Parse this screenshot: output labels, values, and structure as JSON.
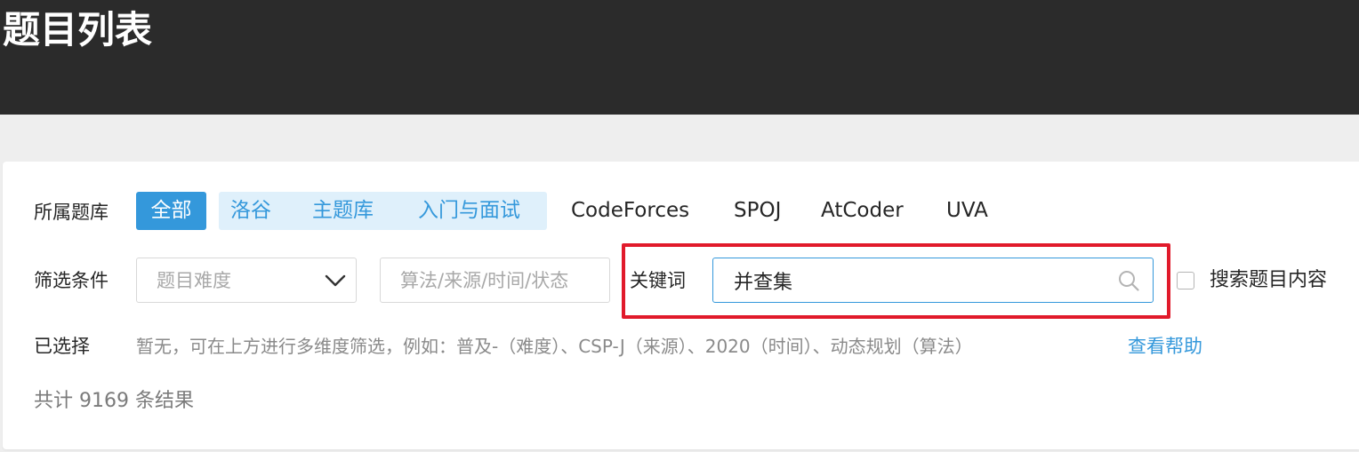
{
  "header": {
    "title": "题目列表"
  },
  "library": {
    "label": "所属题库",
    "all": "全部",
    "group": [
      "洛谷",
      "主题库",
      "入门与面试"
    ],
    "others": [
      "CodeForces",
      "SPOJ",
      "AtCoder",
      "UVA"
    ]
  },
  "filter": {
    "label": "筛选条件",
    "difficulty_placeholder": "题目难度",
    "tags_placeholder": "算法/来源/时间/状态",
    "keyword_label": "关键词",
    "keyword_value": "并查集",
    "search_content_label": "搜索题目内容",
    "search_content_checked": false
  },
  "selected": {
    "label": "已选择",
    "hint": "暂无，可在上方进行多维度筛选，例如：普及-（难度）、CSP-J（来源）、2020（时间）、动态规划（算法）",
    "help_link": "查看帮助"
  },
  "results": {
    "count_text": "共计 9169 条结果"
  },
  "colors": {
    "accent": "#3498db",
    "header_bg": "#2b2b2b",
    "highlight": "#e11a2b",
    "chip_bg": "#dff0fb"
  },
  "icons": {
    "search": "search-icon",
    "dropdown": "chevron-down-icon"
  }
}
